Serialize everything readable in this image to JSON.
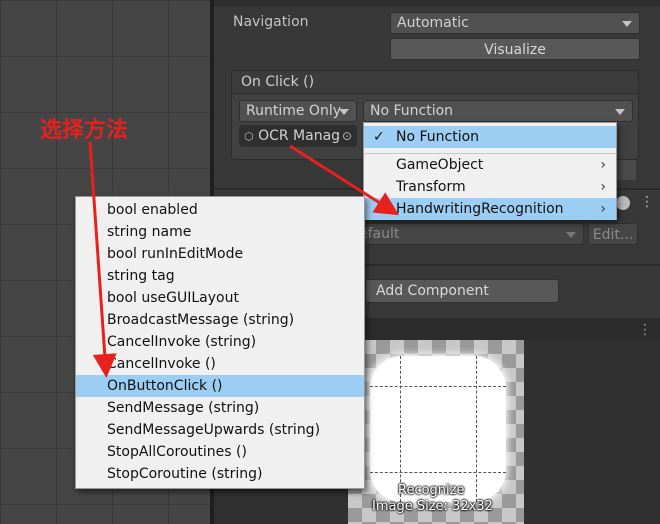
{
  "annotation": {
    "text": "选择方法",
    "color": "#e8211f"
  },
  "inspector": {
    "navigation_label": "Navigation",
    "navigation_value": "Automatic",
    "visualize_label": "Visualize",
    "onclick_header": "On Click ()",
    "runtime_value": "Runtime Only",
    "function_value": "No Function",
    "object_field": "OCR Manag",
    "default_field": "efault",
    "edit_button": "Edit...",
    "add_component": "Add Component"
  },
  "function_menu": {
    "items": [
      {
        "label": "No Function",
        "checked": true,
        "submenu": false
      },
      {
        "label": "GameObject",
        "checked": false,
        "submenu": true
      },
      {
        "label": "Transform",
        "checked": false,
        "submenu": true
      },
      {
        "label": "HandwritingRecognition",
        "checked": false,
        "submenu": true,
        "highlighted": true
      }
    ],
    "check_glyph": "✓",
    "submenu_glyph": "›"
  },
  "method_menu": {
    "items": [
      "bool enabled",
      "string name",
      "bool runInEditMode",
      "string tag",
      "bool useGUILayout",
      "BroadcastMessage (string)",
      "CancelInvoke (string)",
      "CancelInvoke ()",
      "OnButtonClick ()",
      "SendMessage (string)",
      "SendMessageUpwards (string)",
      "StopAllCoroutines ()",
      "StopCoroutine (string)"
    ],
    "selected_index": 8
  },
  "preview": {
    "caption": "Recognize",
    "size_text": "Image Size: 32x32"
  },
  "colors": {
    "selection": "#9ccdf2",
    "panel": "#383838",
    "arrow": "#e8211f"
  }
}
